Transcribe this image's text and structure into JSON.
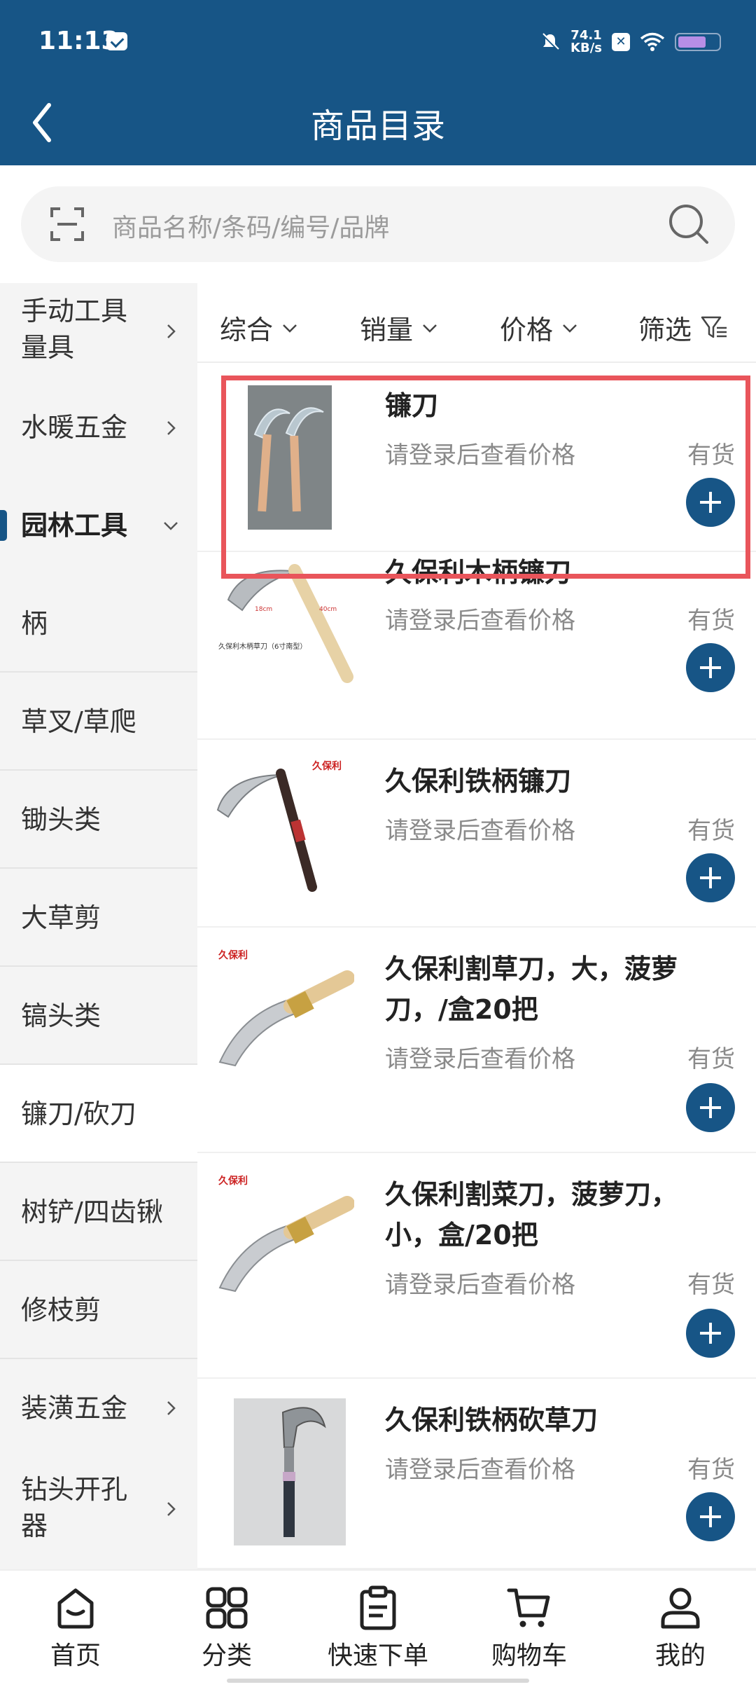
{
  "status_bar": {
    "time": "11:13",
    "net_speed": "74.1",
    "net_unit": "KB/s",
    "battery_level": 0.7
  },
  "header": {
    "title": "商品目录"
  },
  "search": {
    "placeholder": "商品名称/条码/编号/品牌"
  },
  "sidebar": {
    "items": [
      {
        "label": "手动工具\n量具",
        "type": "parent",
        "expanded": false
      },
      {
        "label": "水暖五金",
        "type": "parent",
        "expanded": false
      },
      {
        "label": "园林工具",
        "type": "parent",
        "expanded": true
      },
      {
        "label": "柄",
        "type": "sub"
      },
      {
        "label": "草叉/草爬",
        "type": "sub"
      },
      {
        "label": "锄头类",
        "type": "sub"
      },
      {
        "label": "大草剪",
        "type": "sub"
      },
      {
        "label": "镐头类",
        "type": "sub"
      },
      {
        "label": "镰刀/砍刀",
        "type": "sub",
        "selected": true
      },
      {
        "label": "树铲/四齿锹",
        "type": "sub"
      },
      {
        "label": "修枝剪",
        "type": "sub"
      },
      {
        "label": "装潢五金",
        "type": "parent",
        "expanded": false
      },
      {
        "label": "钻头开孔\n器",
        "type": "parent",
        "expanded": false
      }
    ]
  },
  "filters": [
    {
      "label": "综合"
    },
    {
      "label": "销量"
    },
    {
      "label": "价格"
    },
    {
      "label": "筛选"
    }
  ],
  "products": [
    {
      "name": "镰刀",
      "price": "请登录后查看价格",
      "stock": "有货",
      "image_label": ""
    },
    {
      "name": "久保利木柄镰刀",
      "price": "请登录后查看价格",
      "stock": "有货",
      "image_label": "久保利木柄草刀（6寸南型）"
    },
    {
      "name": "久保利铁柄镰刀",
      "price": "请登录后查看价格",
      "stock": "有货",
      "image_label": "久保利"
    },
    {
      "name": "久保利割草刀，大，菠萝刀，/盒20把",
      "price": "请登录后查看价格",
      "stock": "有货",
      "image_label": "久保利"
    },
    {
      "name": "久保利割菜刀，菠萝刀，小，盒/20把",
      "price": "请登录后查看价格",
      "stock": "有货",
      "image_label": "久保利"
    },
    {
      "name": "久保利铁柄砍草刀",
      "price": "请登录后查看价格",
      "stock": "有货",
      "image_label": ""
    }
  ],
  "tabbar": [
    {
      "label": "首页",
      "icon": "home-icon"
    },
    {
      "label": "分类",
      "icon": "category-icon"
    },
    {
      "label": "快速下单",
      "icon": "clipboard-icon"
    },
    {
      "label": "购物车",
      "icon": "cart-icon"
    },
    {
      "label": "我的",
      "icon": "user-icon"
    }
  ],
  "colors": {
    "brand": "#175586",
    "highlight": "#e9555b"
  }
}
